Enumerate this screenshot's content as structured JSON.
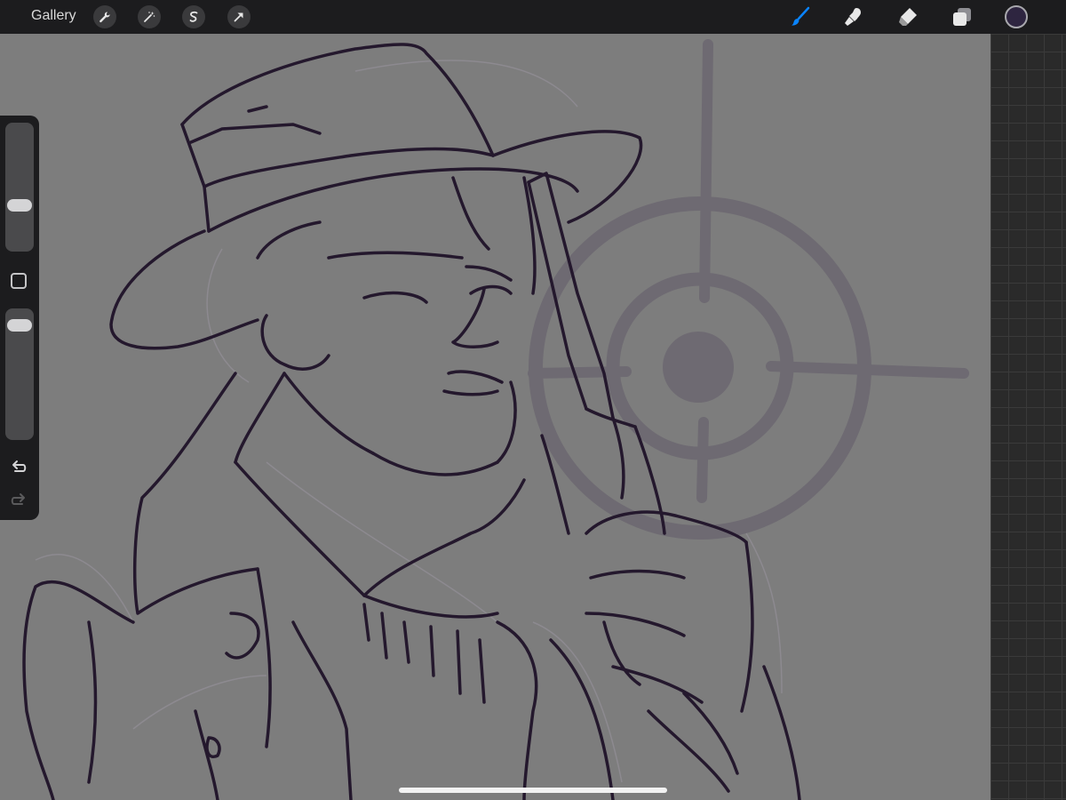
{
  "toolbar": {
    "gallery_label": "Gallery",
    "left_tools": [
      "wrench-icon",
      "magic-wand-icon",
      "selection-icon",
      "transform-arrow-icon"
    ],
    "right_tools": [
      "brush-icon",
      "smudge-icon",
      "eraser-icon",
      "layers-icon"
    ],
    "active_tool": "brush-icon",
    "active_color": "#2e2540",
    "accent_color": "#0a84ff"
  },
  "sidebar": {
    "brush_size_level": 0.34,
    "opacity_level": 0.92,
    "undo_icon": "undo-icon",
    "redo_icon": "redo-icon",
    "redo_enabled": false
  },
  "canvas": {
    "background_color": "#7d7d7d",
    "line_color": "#24182d",
    "target_color": "#6e6a72"
  }
}
